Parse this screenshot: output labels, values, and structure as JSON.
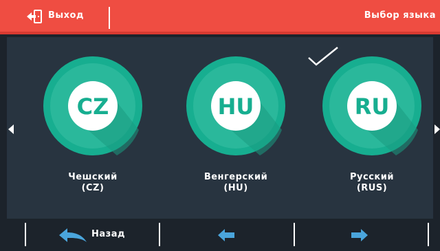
{
  "header": {
    "exit_label": "Выход",
    "title": "Выбор языка",
    "exit_icon": "exit-door-icon",
    "background_color": "#ef4d42"
  },
  "languages": [
    {
      "code": "CZ",
      "name": "Чешский",
      "code_line": "(CZ)",
      "selected": false
    },
    {
      "code": "HU",
      "name": "Венгерский",
      "code_line": "(HU)",
      "selected": false
    },
    {
      "code": "RU",
      "name": "Русский",
      "code_line": "(RUS)",
      "selected": true
    }
  ],
  "footer": {
    "back_label": "Назад",
    "back_icon": "back-arrow-icon",
    "prev_icon": "arrow-left-icon",
    "next_icon": "arrow-right-icon"
  },
  "colors": {
    "accent_blue": "#4aa5dc",
    "circle_green": "#17ae90",
    "panel_bg": "#283440"
  }
}
